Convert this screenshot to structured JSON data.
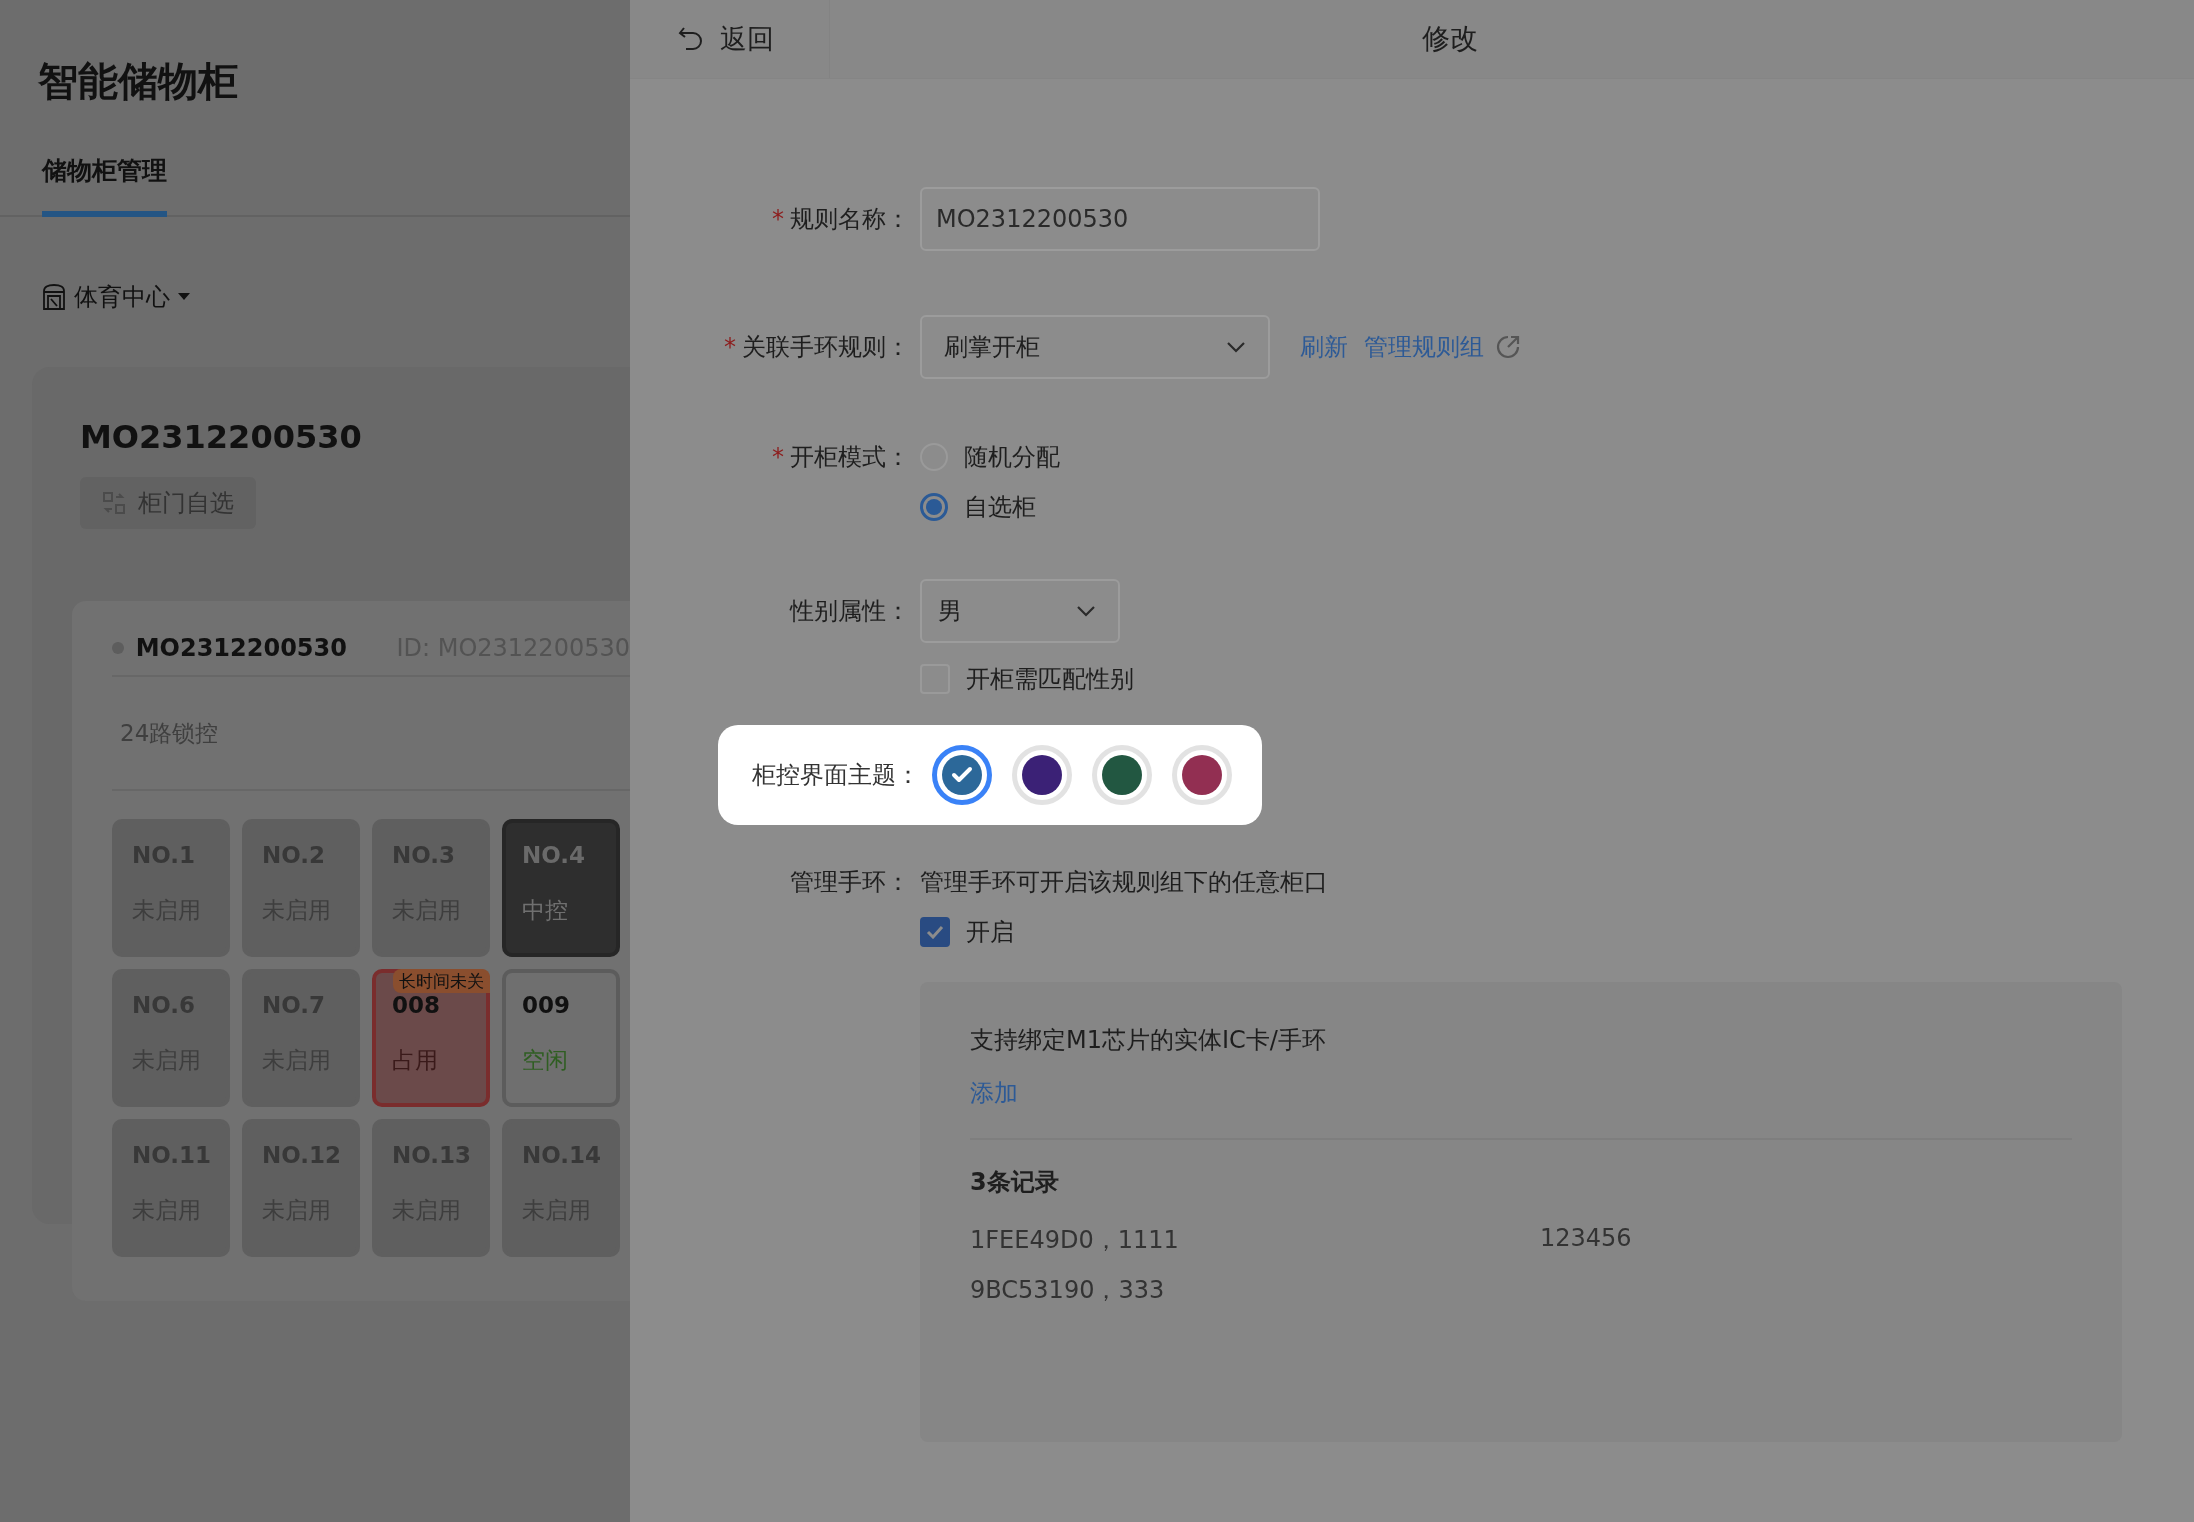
{
  "app": {
    "title": "智能储物柜"
  },
  "tabs": [
    {
      "label": "储物柜管理",
      "selected": true
    }
  ],
  "venue_selector": {
    "label": "体育中心"
  },
  "cabinet": {
    "name": "MO2312200530",
    "mode_button": "柜门自选",
    "device": {
      "name": "MO2312200530",
      "id": "ID: MO2312200530",
      "lock_type": "24路锁控",
      "lockers": [
        {
          "number": "NO.1",
          "status": "未启用",
          "kind": "disabled"
        },
        {
          "number": "NO.2",
          "status": "未启用",
          "kind": "disabled"
        },
        {
          "number": "NO.3",
          "status": "未启用",
          "kind": "disabled"
        },
        {
          "number": "NO.4",
          "status": "中控",
          "kind": "control"
        },
        {
          "number": "NO.6",
          "status": "未启用",
          "kind": "disabled"
        },
        {
          "number": "NO.7",
          "status": "未启用",
          "kind": "disabled"
        },
        {
          "number": "008",
          "status": "占用",
          "kind": "occupied",
          "badge": "长时间未关"
        },
        {
          "number": "009",
          "status": "空闲",
          "kind": "free"
        },
        {
          "number": "NO.11",
          "status": "未启用",
          "kind": "disabled"
        },
        {
          "number": "NO.12",
          "status": "未启用",
          "kind": "disabled"
        },
        {
          "number": "NO.13",
          "status": "未启用",
          "kind": "disabled"
        },
        {
          "number": "NO.14",
          "status": "未启用",
          "kind": "disabled"
        }
      ]
    }
  },
  "drawer": {
    "back": "返回",
    "title": "修改",
    "form": {
      "rule_name": {
        "required_mark": "*",
        "label": "规则名称：",
        "value": "MO2312200530"
      },
      "band_rule": {
        "required_mark": "*",
        "label": "关联手环规则：",
        "value": "刷掌开柜",
        "refresh": "刷新",
        "manage_link": "管理规则组"
      },
      "open_mode": {
        "required_mark": "*",
        "label": "开柜模式：",
        "options": [
          {
            "label": "随机分配",
            "selected": false
          },
          {
            "label": "自选柜",
            "selected": true
          }
        ]
      },
      "gender": {
        "label": "性别属性：",
        "value": "男",
        "match_checkbox": {
          "label": "开柜需匹配性别",
          "checked": false
        }
      },
      "theme": {
        "label": "柜控界面主题：",
        "highlighted": true,
        "swatches": [
          {
            "color": "#2c6899",
            "selected": true
          },
          {
            "color": "#3b2176",
            "selected": false
          },
          {
            "color": "#225741",
            "selected": false
          },
          {
            "color": "#922f52",
            "selected": false
          }
        ]
      },
      "admin_band": {
        "label": "管理手环：",
        "description": "管理手环可开启该规则组下的任意柜口",
        "enable": {
          "label": "开启",
          "checked": true
        },
        "panel": {
          "hint": "支持绑定M1芯片的实体IC卡/手环",
          "add_link": "添加",
          "record_count": "3条记录",
          "records": [
            {
              "card": "1FEE49D0，1111",
              "column_2": "123456"
            },
            {
              "card": "9BC53190，333"
            }
          ]
        }
      }
    }
  }
}
